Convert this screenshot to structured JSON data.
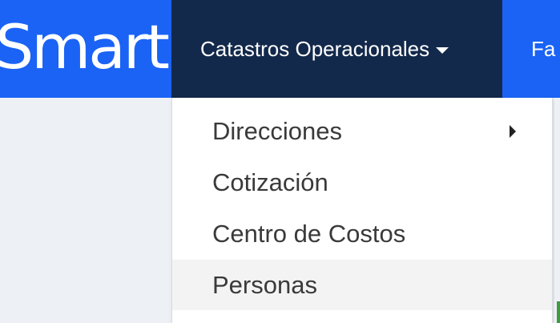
{
  "header": {
    "logo_text": "Smart",
    "active_nav_label": "Catastros Operacionales",
    "next_nav_label": "Fa"
  },
  "dropdown": {
    "items": [
      {
        "label": "Direcciones",
        "has_submenu": true
      },
      {
        "label": "Cotización",
        "has_submenu": false
      },
      {
        "label": "Centro de Costos",
        "has_submenu": false
      },
      {
        "label": "Personas",
        "has_submenu": false,
        "hovered": true
      }
    ]
  },
  "colors": {
    "topbar": "#1a63f5",
    "active_nav": "#13294b",
    "page_bg": "#edf0f5",
    "hover_bg": "#f3f3f3"
  }
}
